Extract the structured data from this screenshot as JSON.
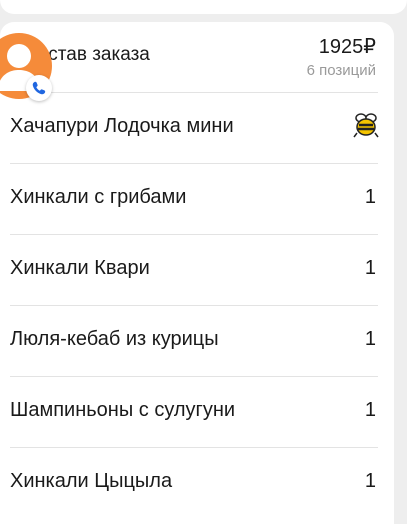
{
  "order": {
    "title": "Состав заказа",
    "total": "1925₽",
    "count": "6 позиций"
  },
  "items": [
    {
      "name": "Хачапури Лодочка мини",
      "qty": ""
    },
    {
      "name": "Хинкали с грибами",
      "qty": "1"
    },
    {
      "name": "Хинкали Квари",
      "qty": "1"
    },
    {
      "name": "Люля-кебаб из курицы",
      "qty": "1"
    },
    {
      "name": "Шампиньоны с сулугуни",
      "qty": "1"
    },
    {
      "name": "Хинкали Цыцыла",
      "qty": "1"
    }
  ],
  "icons": {
    "avatar": "person-icon",
    "badge": "phone-icon",
    "row0_marker": "bee-icon"
  },
  "colors": {
    "avatar_bg": "#f58b3a",
    "phone": "#1f66e0",
    "bee_yellow": "#f4c400"
  }
}
